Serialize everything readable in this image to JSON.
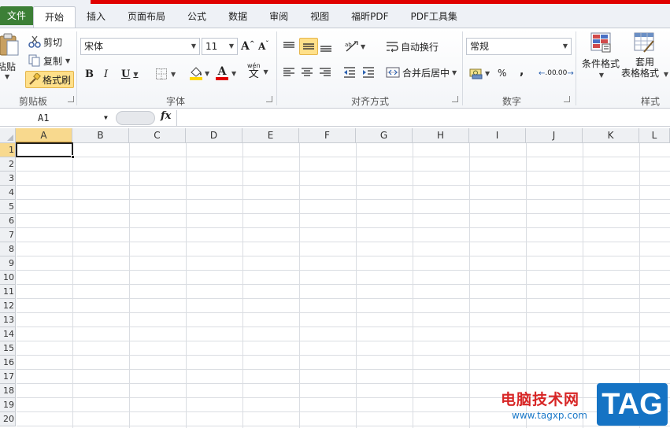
{
  "tabs": {
    "file": "文件",
    "items": [
      "开始",
      "插入",
      "页面布局",
      "公式",
      "数据",
      "审阅",
      "视图",
      "福昕PDF",
      "PDF工具集"
    ],
    "active_index": 0
  },
  "ribbon": {
    "clipboard": {
      "paste": "粘贴",
      "cut": "剪切",
      "copy": "复制",
      "format_painter": "格式刷",
      "group_label": "剪贴板"
    },
    "font": {
      "font_name": "宋体",
      "font_size": "11",
      "bold": "B",
      "italic": "I",
      "underline": "U",
      "grow": "A",
      "shrink": "A",
      "font_color": "A",
      "phonetic": "文",
      "phonetic_top": "wén",
      "group_label": "字体",
      "font_color_hex": "#e00000",
      "fill_color_hex": "#ffd700"
    },
    "alignment": {
      "wrap_text": "自动换行",
      "merge_center": "合并后居中",
      "group_label": "对齐方式"
    },
    "number": {
      "format": "常规",
      "percent": "%",
      "comma": ",",
      "inc_decimal": ".00",
      "dec_decimal": ".00",
      "group_label": "数字"
    },
    "styles": {
      "conditional": "条件格式",
      "table_style_1": "套用",
      "table_style_2": "表格格式",
      "group_label": "样式"
    }
  },
  "formula_bar": {
    "name_box": "A1",
    "fx": "fx",
    "value": ""
  },
  "grid": {
    "columns": [
      "A",
      "B",
      "C",
      "D",
      "E",
      "F",
      "G",
      "H",
      "I",
      "J",
      "K",
      "L"
    ],
    "rows": [
      "1",
      "2",
      "3",
      "4",
      "5",
      "6",
      "7",
      "8",
      "9",
      "10",
      "11",
      "12",
      "13",
      "14",
      "15",
      "16",
      "17",
      "18",
      "19",
      "20"
    ],
    "active_cell": "A1"
  },
  "watermark": {
    "text": "电脑技术网",
    "url": "www.tagxp.com",
    "tag": "TAG"
  }
}
